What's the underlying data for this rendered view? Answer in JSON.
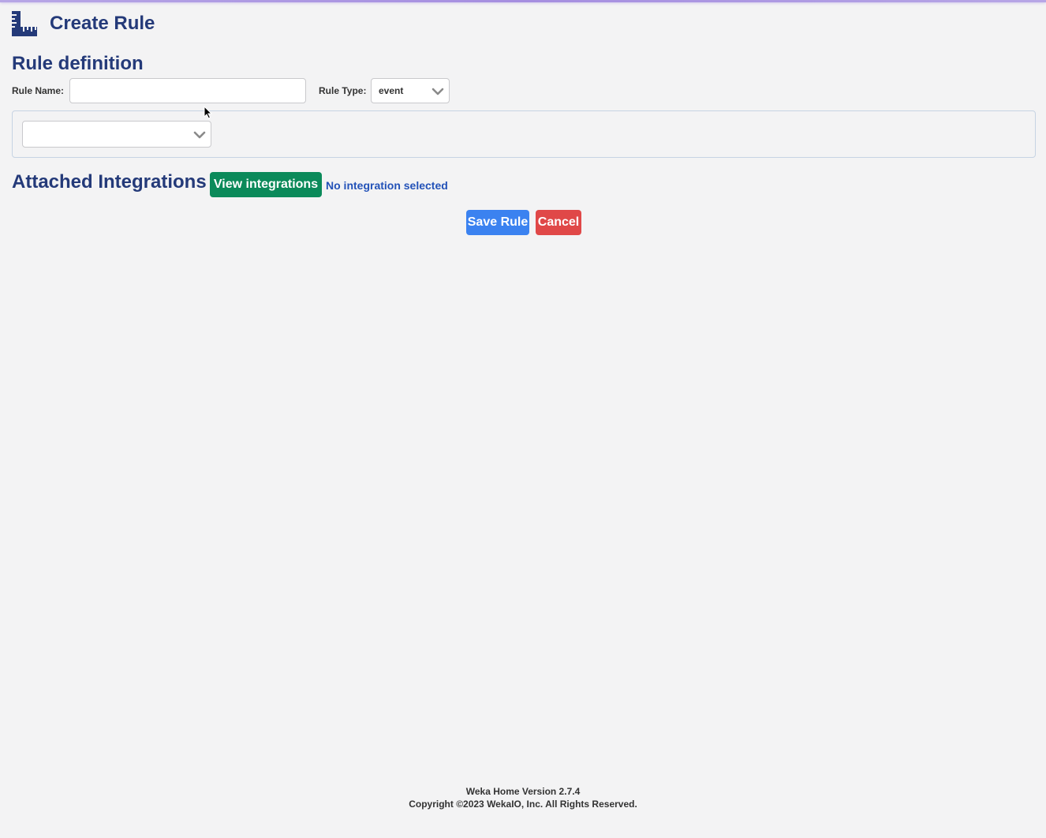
{
  "header": {
    "title": "Create Rule",
    "icon": "ruler-icon"
  },
  "section": {
    "title": "Rule definition"
  },
  "form": {
    "rule_name_label": "Rule Name:",
    "rule_name_value": "",
    "rule_type_label": "Rule Type:",
    "rule_type_value": "event",
    "condition_value": ""
  },
  "integrations": {
    "title": "Attached Integrations",
    "view_button": "View integrations",
    "status": "No integration selected"
  },
  "actions": {
    "save": "Save Rule",
    "cancel": "Cancel"
  },
  "footer": {
    "version": "Weka Home Version 2.7.4",
    "copyright": "Copyright ©2023 WekaIO, Inc. All Rights Reserved."
  },
  "colors": {
    "title": "#243a79",
    "view_button": "#0b8a5a",
    "save_button": "#3b82f0",
    "cancel_button": "#e04848",
    "status_text": "#2352b8",
    "background": "#f3f3f4"
  }
}
